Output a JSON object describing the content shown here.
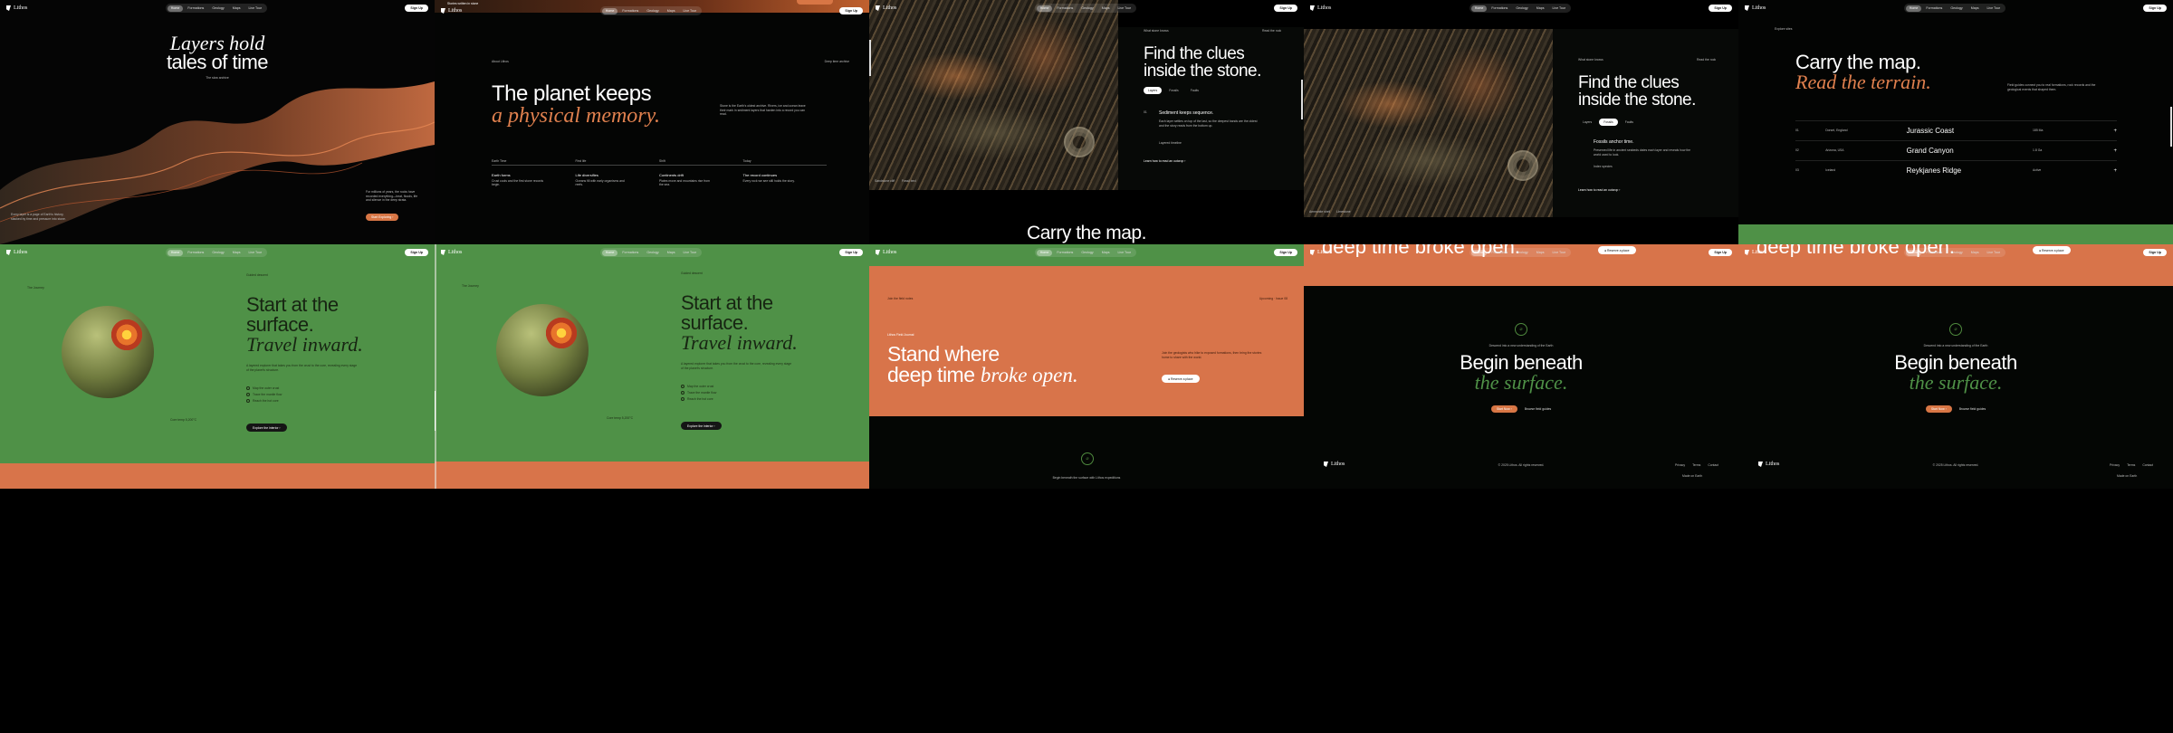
{
  "nav": {
    "brand": "Lithos",
    "links": [
      "Home",
      "Formations",
      "Geology",
      "Maps",
      "Live Tour"
    ],
    "signup": "Sign Up"
  },
  "f1": {
    "title_l1": "Layers hold",
    "title_l2": "tales of time",
    "kicker": "The slow archive",
    "left_caption": "Every layer is a page of Earth's history, stacked by time and pressure into stone.",
    "right_caption": "For millions of years, the rocks have recorded everything—heat, floods, life and silence in the deep strata.",
    "cta": "Start Exploring"
  },
  "f2": {
    "top_overlay": "Stories written in stone",
    "eyebrow_left": "About Lithos",
    "eyebrow_right": "Deep time archive",
    "title_l1": "The planet keeps",
    "title_l2": "a physical memory.",
    "body": "Stone is the Earth's oldest archive. Rivers, ice and ocean leave their mark in sediment layers that harden into a record you can read.",
    "cols": [
      {
        "k": "Earth Time",
        "t": "Earth forms",
        "d": "Crust cools and the first stone records begin."
      },
      {
        "k": "First life",
        "t": "Life diversifies",
        "d": "Oceans fill with early organisms and reefs."
      },
      {
        "k": "Shift",
        "t": "Continents drift",
        "d": "Plates move and mountains rise from the sea."
      },
      {
        "k": "Today",
        "t": "The record continues",
        "d": "Every rock we see still holds the story."
      }
    ]
  },
  "f3": {
    "eyebrow": "What stone knows",
    "eyebrow_right": "Read the rock",
    "title_l1": "Find the clues",
    "title_l2": "inside the stone.",
    "tabs": [
      "Layers",
      "Fossils",
      "Faults"
    ],
    "item_num": "01",
    "item_title": "Sediment keeps sequence.",
    "item_body": "Each layer settles on top of the last, so the deepest bands are the oldest and the story reads from the bottom up.",
    "item_meta": "Layered timeline",
    "link": "Learn how to read an outcrop",
    "img_caption": "Sandstone cliff",
    "img_sub": "Fossil bed",
    "overlay": "Carry the map."
  },
  "f4": {
    "eyebrow": "What stone knows",
    "eyebrow_right": "Read the rock",
    "title_l1": "Find the clues",
    "title_l2": "inside the stone.",
    "tabs": [
      "Layers",
      "Fossils",
      "Faults"
    ],
    "item_title": "Fossils anchor time.",
    "item_body": "Preserved life in ancient seabeds dates each layer and reveals how the world used to look.",
    "item_meta": "Index species",
    "link": "Learn how to read an outcrop",
    "img_caption": "Ammonite shell",
    "img_sub": "Limestone"
  },
  "f5": {
    "eyebrow": "Explore sites",
    "title_l1": "Carry the map.",
    "title_l2": "Read the terrain.",
    "body": "Field guides connect you to real formations, rock records and the geological events that shaped them.",
    "sites": [
      {
        "n": "01",
        "r": "Dorset, England",
        "name": "Jurassic Coast",
        "age": "185 Ma"
      },
      {
        "n": "02",
        "r": "Arizona, USA",
        "name": "Grand Canyon",
        "age": "1.8 Ga"
      },
      {
        "n": "03",
        "r": "Iceland",
        "name": "Reykjanes Ridge",
        "age": "Active"
      }
    ]
  },
  "f6": {
    "eyebrow": "The Journey",
    "tag": "Guided descent",
    "title_l1": "Start at the",
    "title_l2": "surface.",
    "title_l3": "Travel inward.",
    "body": "A layered explorer that takes you from the crust to the core, revealing every stage of the planet's structure.",
    "steps": [
      "Map the outer crust",
      "Trace the mantle flow",
      "Reach the hot core"
    ],
    "cta": "Explore the interior",
    "side": "Core temp 5,200°C"
  },
  "f8": {
    "eyebrow": "Join the field notes",
    "eyebrow_right": "Upcoming · Issue 08",
    "tag": "Lithos Field Journal",
    "title_l1": "Stand where",
    "title_l2": "deep time",
    "title_l3": "broke open.",
    "body": "Join the geologists who hike to exposed formations, then bring the stories home to share with the world.",
    "cta": "Reserve a place",
    "footer_note": "Begin beneath the surface with Lithos expeditions"
  },
  "f9": {
    "overlay": "deep time broke open.",
    "overlay_cta": "Reserve a place",
    "eyebrow": "Descend into a new understanding of the Earth",
    "title_l1": "Begin beneath",
    "title_l2": "the surface.",
    "cta_primary": "Start Now",
    "cta_secondary": "Browse field guides",
    "copyright": "© 2025 Lithos. All rights reserved.",
    "footer_links": [
      "Privacy",
      "Terms",
      "Contact"
    ],
    "footer_sub": "Made on Earth"
  }
}
